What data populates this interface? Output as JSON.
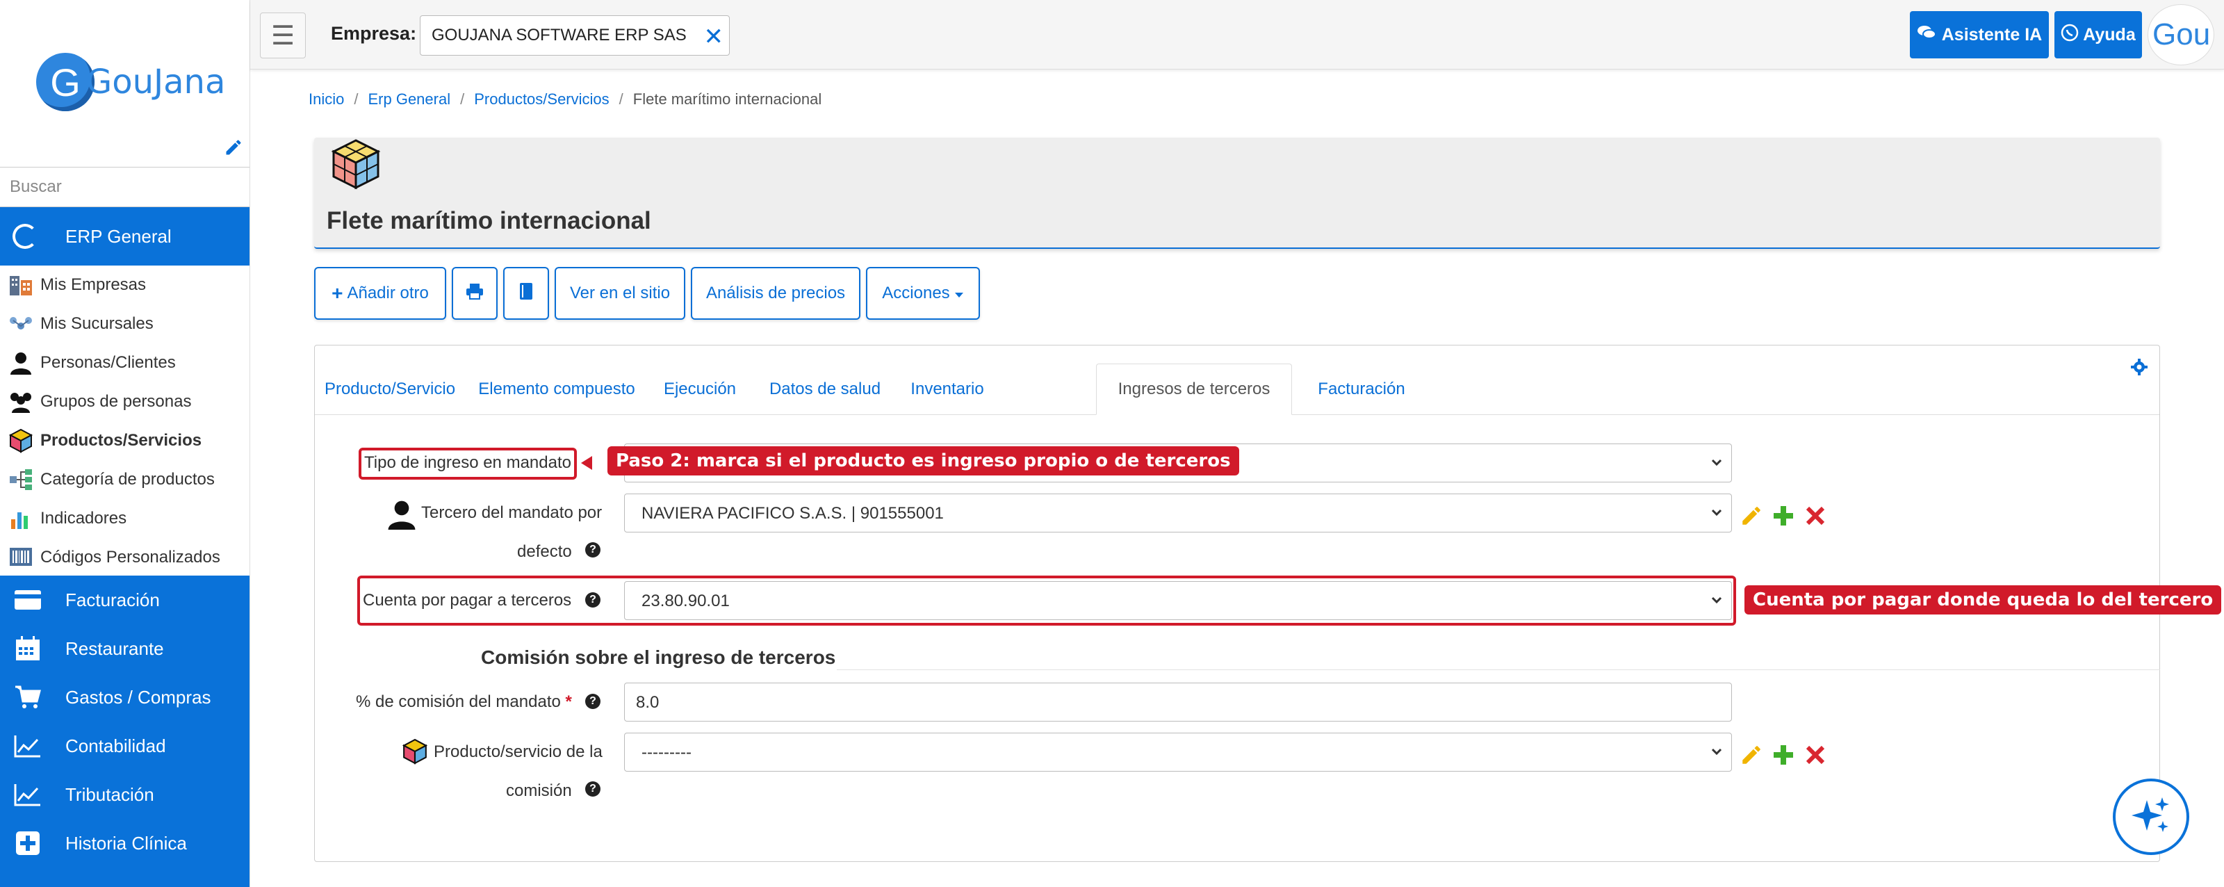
{
  "sidebar": {
    "logo_letter": "G",
    "logo_text": "GouJana",
    "search_placeholder": "Buscar",
    "active_module": "ERP General",
    "sub_items": [
      {
        "label": "Mis Empresas",
        "icon": "buildings-icon"
      },
      {
        "label": "Mis Sucursales",
        "icon": "network-icon"
      },
      {
        "label": "Personas/Clientes",
        "icon": "user-icon"
      },
      {
        "label": "Grupos de personas",
        "icon": "users-icon"
      },
      {
        "label": "Productos/Servicios",
        "icon": "cube-icon"
      },
      {
        "label": "Categoría de productos",
        "icon": "tree-icon"
      },
      {
        "label": "Indicadores",
        "icon": "bar-chart-icon"
      },
      {
        "label": "Códigos Personalizados",
        "icon": "barcode-icon"
      }
    ],
    "modules": [
      {
        "label": "Facturación",
        "icon": "card-icon"
      },
      {
        "label": "Restaurante",
        "icon": "calendar-icon"
      },
      {
        "label": "Gastos / Compras",
        "icon": "cart-icon"
      },
      {
        "label": "Contabilidad",
        "icon": "line-chart-icon"
      },
      {
        "label": "Tributación",
        "icon": "line-chart-icon"
      },
      {
        "label": "Historia Clínica",
        "icon": "plus-square-icon"
      }
    ]
  },
  "topbar": {
    "empresa_label": "Empresa:",
    "empresa_value": "GOUJANA SOFTWARE ERP SAS",
    "asistente_label": "Asistente IA",
    "ayuda_label": "Ayuda",
    "avatar_text": "Gou"
  },
  "breadcrumb": {
    "items": [
      "Inicio",
      "Erp General",
      "Productos/Servicios"
    ],
    "current": "Flete marítimo internacional"
  },
  "page": {
    "title": "Flete marítimo internacional"
  },
  "actions": {
    "add_label": "Añadir otro",
    "view_label": "Ver en el sitio",
    "analysis_label": "Análisis de precios",
    "actions_label": "Acciones"
  },
  "tabs": [
    "Producto/Servicio",
    "Elemento compuesto",
    "Ejecución",
    "Datos de salud",
    "Inventario",
    "Ingresos de terceros",
    "Facturación"
  ],
  "form": {
    "tipo_label": "Tipo de ingreso en mandato",
    "tipo_value": "",
    "tercero_label_1": "Tercero del mandato por",
    "tercero_label_2": "defecto",
    "tercero_value": "NAVIERA PACIFICO S.A.S. | 901555001",
    "cuenta_label": "Cuenta por pagar a terceros",
    "cuenta_value": "23.80.90.01",
    "section_title": "Comisión sobre el ingreso de terceros",
    "comision_label": "% de comisión del mandato",
    "required_mark": "*",
    "comision_value": "8.0",
    "producto_label_1": "Producto/servicio de la",
    "producto_label_2": "comisión",
    "producto_value": "---------"
  },
  "callouts": {
    "paso2": "Paso 2: marca si el producto es ingreso propio o de terceros",
    "cuenta": "Cuenta por pagar donde queda lo del tercero"
  },
  "colors": {
    "primary": "#0a72d9",
    "highlight": "#d11a2a",
    "edit": "#f0b400",
    "add": "#3fae2a",
    "delete": "#d9262f"
  }
}
